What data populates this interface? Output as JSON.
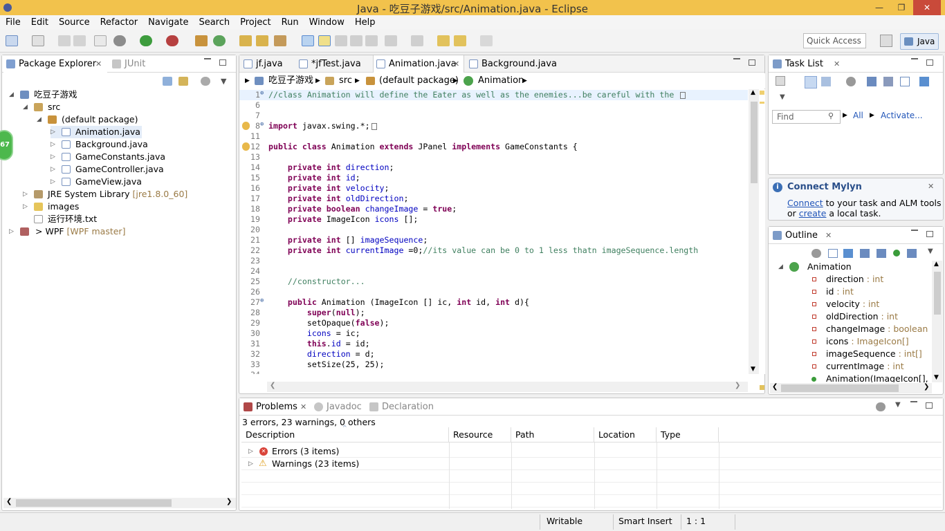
{
  "window": {
    "title": "Java - 吃豆子游戏/src/Animation.java - Eclipse"
  },
  "menu": [
    "File",
    "Edit",
    "Source",
    "Refactor",
    "Navigate",
    "Search",
    "Project",
    "Run",
    "Window",
    "Help"
  ],
  "toolbar": {
    "quick_access": "Quick Access",
    "perspective": "Java"
  },
  "package_explorer": {
    "tab_label": "Package Explorer",
    "junit_tab": "JUnit",
    "badge": "67",
    "project": "吃豆子游戏",
    "src": "src",
    "default_package": "(default package)",
    "files": [
      "Animation.java",
      "Background.java",
      "GameConstants.java",
      "GameController.java",
      "GameView.java"
    ],
    "jre": "JRE System Library",
    "jre_version": "[jre1.8.0_60]",
    "images": "images",
    "txt": "运行环境.txt",
    "wpf_prefix": ">",
    "wpf": "WPF",
    "wpf_branch": "[WPF master]"
  },
  "editor": {
    "tabs": [
      "jf.java",
      "*jfTest.java",
      "Animation.java",
      "Background.java"
    ],
    "breadcrumb": [
      "吃豆子游戏",
      "src",
      "(default package)",
      "Animation"
    ],
    "lines": [
      {
        "n": "1",
        "html": "<span class='cm'>//class Animation will define the Eater as well as the enemies...be careful with the </span>"
      },
      {
        "n": "6",
        "html": ""
      },
      {
        "n": "7",
        "html": ""
      },
      {
        "n": "8",
        "html": "<span class='kw'>import</span> javax.swing.*;"
      },
      {
        "n": "11",
        "html": ""
      },
      {
        "n": "12",
        "html": "<span class='kw'>public class</span> Animation <span class='kw'>extends</span> JPanel <span class='kw'>implements</span> GameConstants {"
      },
      {
        "n": "13",
        "html": ""
      },
      {
        "n": "14",
        "html": "    <span class='kw'>private int</span> <span class='fd'>direction</span>;"
      },
      {
        "n": "15",
        "html": "    <span class='kw'>private int</span> <span class='fd'>id</span>;"
      },
      {
        "n": "16",
        "html": "    <span class='kw'>private int</span> <span class='fd'>velocity</span>;"
      },
      {
        "n": "17",
        "html": "    <span class='kw'>private int</span> <span class='fd'>oldDirection</span>;"
      },
      {
        "n": "18",
        "html": "    <span class='kw'>private boolean</span> <span class='fd'>changeImage</span> = <span class='kw'>true</span>;"
      },
      {
        "n": "19",
        "html": "    <span class='kw'>private</span> ImageIcon <span class='fd'>icons</span> [];"
      },
      {
        "n": "20",
        "html": ""
      },
      {
        "n": "21",
        "html": "    <span class='kw'>private int</span> [] <span class='fd'>imageSequence</span>;"
      },
      {
        "n": "22",
        "html": "    <span class='kw'>private int</span> <span class='fd'>currentImage</span> =0;<span class='cm'>//its value can be 0 to 1 less thatn imageSequence.length</span>"
      },
      {
        "n": "23",
        "html": ""
      },
      {
        "n": "24",
        "html": ""
      },
      {
        "n": "25",
        "html": "    <span class='cm'>//constructor...</span>"
      },
      {
        "n": "26",
        "html": ""
      },
      {
        "n": "27",
        "html": "    <span class='kw'>public</span> Animation (ImageIcon [] ic, <span class='kw'>int</span> id, <span class='kw'>int</span> d){"
      },
      {
        "n": "28",
        "html": "        <span class='kw'>super</span>(<span class='kw'>null</span>);"
      },
      {
        "n": "29",
        "html": "        setOpaque(<span class='kw'>false</span>);"
      },
      {
        "n": "30",
        "html": "        <span class='fd'>icons</span> = ic;"
      },
      {
        "n": "31",
        "html": "        <span class='kw'>this</span>.<span class='fd'>id</span> = id;"
      },
      {
        "n": "32",
        "html": "        <span class='fd'>direction</span> = d;"
      },
      {
        "n": "33",
        "html": "        setSize(25, 25);"
      },
      {
        "n": "34",
        "html": ""
      }
    ]
  },
  "task_list": {
    "tab_label": "Task List",
    "find_placeholder": "Find",
    "all": "All",
    "activate": "Activate..."
  },
  "mylyn": {
    "title": "Connect Mylyn",
    "connect": "Connect",
    "text1": " to your task and ALM tools",
    "or": "or ",
    "create": "create",
    "text2": " a local task."
  },
  "outline": {
    "tab_label": "Outline",
    "class_name": "Animation",
    "fields": [
      {
        "name": "direction",
        "type": " : int"
      },
      {
        "name": "id",
        "type": " : int"
      },
      {
        "name": "velocity",
        "type": " : int"
      },
      {
        "name": "oldDirection",
        "type": " : int"
      },
      {
        "name": "changeImage",
        "type": " : boolean"
      },
      {
        "name": "icons",
        "type": " : ImageIcon[]"
      },
      {
        "name": "imageSequence",
        "type": " : int[]"
      },
      {
        "name": "currentImage",
        "type": " : int"
      },
      {
        "name": "Animation(ImageIcon[], in",
        "type": ""
      }
    ]
  },
  "problems": {
    "tab_label": "Problems",
    "javadoc_tab": "Javadoc",
    "declaration_tab": "Declaration",
    "summary": "3 errors, 23 warnings, 0 others",
    "columns": [
      "Description",
      "Resource",
      "Path",
      "Location",
      "Type"
    ],
    "rows": [
      {
        "label": "Errors (3 items)"
      },
      {
        "label": "Warnings (23 items)"
      }
    ]
  },
  "status": {
    "writable": "Writable",
    "insert": "Smart Insert",
    "position": "1 : 1"
  },
  "colors": {
    "title_bar": "#f2c24c",
    "keyword": "#7f0055",
    "comment": "#3f7f5f",
    "field": "#0000c0"
  }
}
